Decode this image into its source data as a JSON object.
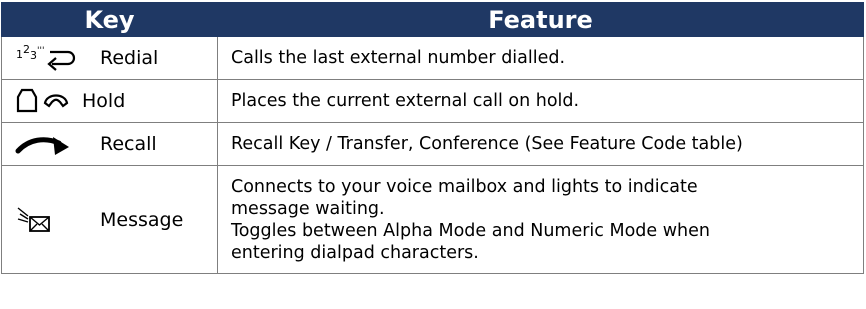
{
  "header": {
    "key": "Key",
    "feature": "Feature"
  },
  "rows": [
    {
      "key_label": "Redial",
      "icon": "redial-icon",
      "icon_text": "1²3′′",
      "feature": "Calls the last external number dialled."
    },
    {
      "key_label": "Hold",
      "icon": "hold-icon",
      "feature": "Places the current external call on hold."
    },
    {
      "key_label": "Recall",
      "icon": "recall-icon",
      "feature": "Recall Key / Transfer, Conference (See Feature Code table)"
    },
    {
      "key_label": "Message",
      "icon": "message-icon",
      "feature_lines": [
        "Connects to your voice mailbox and lights to indicate",
        "message waiting.",
        "Toggles between Alpha Mode and Numeric Mode when",
        "entering dialpad characters."
      ]
    }
  ],
  "colors": {
    "header_bg": "#1f3864",
    "header_text": "#ffffff",
    "border": "#7f7f7f"
  }
}
